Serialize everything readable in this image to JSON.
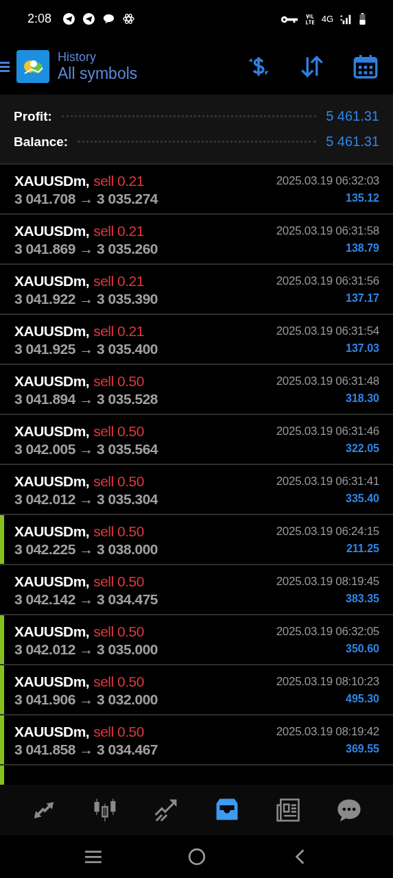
{
  "status_bar": {
    "time": "2:08",
    "network": "4G"
  },
  "header": {
    "title": "History",
    "subtitle": "All symbols"
  },
  "summary": [
    {
      "label": "Profit:",
      "value": "5 461.31"
    },
    {
      "label": "Balance:",
      "value": "5 461.31"
    }
  ],
  "deals": [
    {
      "symbol": "XAUUSDm,",
      "side": "sell 0.21",
      "prices": "3 041.708 → 3 035.274",
      "time": "2025.03.19 06:32:03",
      "profit": "135.12",
      "marked": false
    },
    {
      "symbol": "XAUUSDm,",
      "side": "sell 0.21",
      "prices": "3 041.869 → 3 035.260",
      "time": "2025.03.19 06:31:58",
      "profit": "138.79",
      "marked": false
    },
    {
      "symbol": "XAUUSDm,",
      "side": "sell 0.21",
      "prices": "3 041.922 → 3 035.390",
      "time": "2025.03.19 06:31:56",
      "profit": "137.17",
      "marked": false
    },
    {
      "symbol": "XAUUSDm,",
      "side": "sell 0.21",
      "prices": "3 041.925 → 3 035.400",
      "time": "2025.03.19 06:31:54",
      "profit": "137.03",
      "marked": false
    },
    {
      "symbol": "XAUUSDm,",
      "side": "sell 0.50",
      "prices": "3 041.894 → 3 035.528",
      "time": "2025.03.19 06:31:48",
      "profit": "318.30",
      "marked": false
    },
    {
      "symbol": "XAUUSDm,",
      "side": "sell 0.50",
      "prices": "3 042.005 → 3 035.564",
      "time": "2025.03.19 06:31:46",
      "profit": "322.05",
      "marked": false
    },
    {
      "symbol": "XAUUSDm,",
      "side": "sell 0.50",
      "prices": "3 042.012 → 3 035.304",
      "time": "2025.03.19 06:31:41",
      "profit": "335.40",
      "marked": false
    },
    {
      "symbol": "XAUUSDm,",
      "side": "sell 0.50",
      "prices": "3 042.225 → 3 038.000",
      "time": "2025.03.19 06:24:15",
      "profit": "211.25",
      "marked": true
    },
    {
      "symbol": "XAUUSDm,",
      "side": "sell 0.50",
      "prices": "3 042.142 → 3 034.475",
      "time": "2025.03.19 08:19:45",
      "profit": "383.35",
      "marked": false
    },
    {
      "symbol": "XAUUSDm,",
      "side": "sell 0.50",
      "prices": "3 042.012 → 3 035.000",
      "time": "2025.03.19 06:32:05",
      "profit": "350.60",
      "marked": true
    },
    {
      "symbol": "XAUUSDm,",
      "side": "sell 0.50",
      "prices": "3 041.906 → 3 032.000",
      "time": "2025.03.19 08:10:23",
      "profit": "495.30",
      "marked": true
    },
    {
      "symbol": "XAUUSDm,",
      "side": "sell 0.50",
      "prices": "3 041.858 → 3 034.467",
      "time": "2025.03.19 08:19:42",
      "profit": "369.55",
      "marked": true
    },
    {
      "marked": true
    }
  ],
  "bottom_nav": [
    {
      "kind": "quotes",
      "selected": false
    },
    {
      "kind": "chart",
      "selected": false
    },
    {
      "kind": "trade",
      "selected": false
    },
    {
      "kind": "history",
      "selected": true
    },
    {
      "kind": "news",
      "selected": false
    },
    {
      "kind": "chat",
      "selected": false
    }
  ]
}
